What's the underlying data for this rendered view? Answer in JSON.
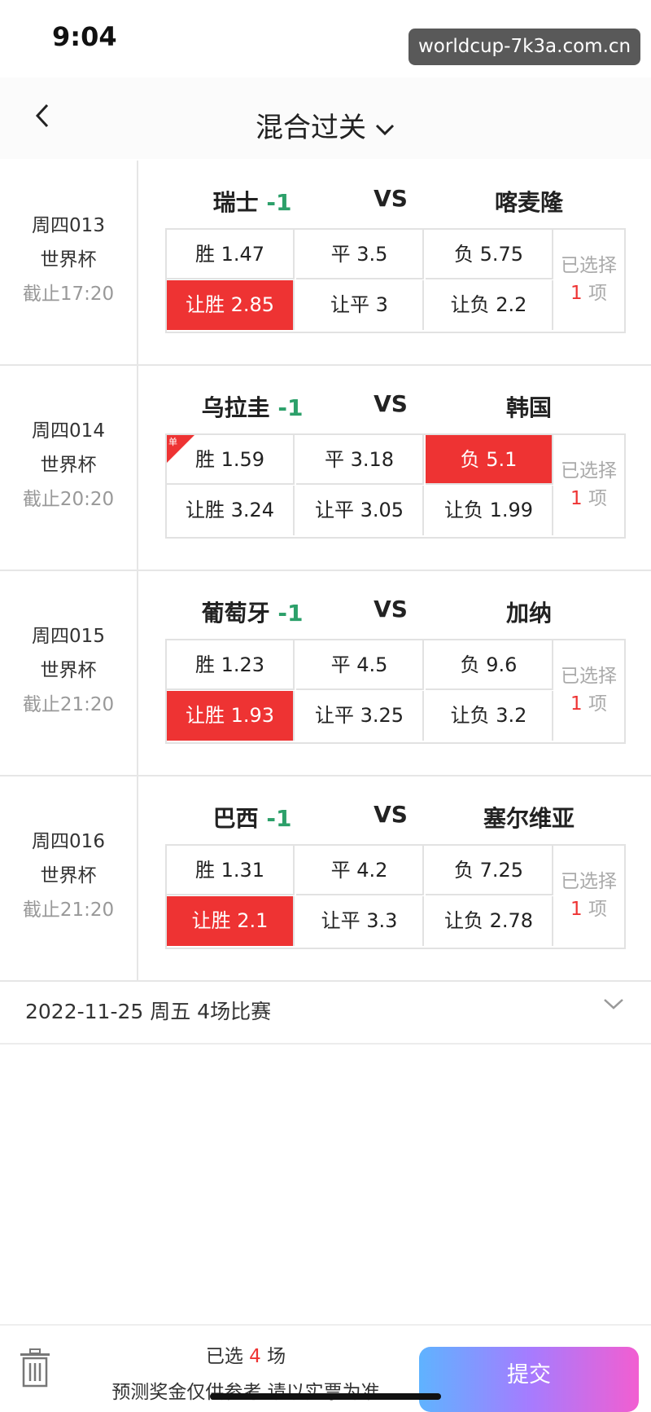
{
  "status": {
    "time": "9:04",
    "watermark": "worldcup-7k3a.com.cn"
  },
  "nav": {
    "title": "混合过关"
  },
  "matches": [
    {
      "code": "周四013",
      "league": "世界杯",
      "deadline": "截止17:20",
      "home": "瑞士",
      "handicap": "-1",
      "vs": "VS",
      "away": "喀麦隆",
      "odds": [
        "胜 1.47",
        "平 3.5",
        "负 5.75",
        "让胜 2.85",
        "让平 3",
        "让负 2.2"
      ],
      "selected": [
        3
      ],
      "single": false,
      "count_prefix": "已选择",
      "count": "1",
      "count_suffix": "项"
    },
    {
      "code": "周四014",
      "league": "世界杯",
      "deadline": "截止20:20",
      "home": "乌拉圭",
      "handicap": "-1",
      "vs": "VS",
      "away": "韩国",
      "odds": [
        "胜 1.59",
        "平 3.18",
        "负 5.1",
        "让胜 3.24",
        "让平 3.05",
        "让负 1.99"
      ],
      "selected": [
        2
      ],
      "single": true,
      "single_label": "单",
      "count_prefix": "已选择",
      "count": "1",
      "count_suffix": "项"
    },
    {
      "code": "周四015",
      "league": "世界杯",
      "deadline": "截止21:20",
      "home": "葡萄牙",
      "handicap": "-1",
      "vs": "VS",
      "away": "加纳",
      "odds": [
        "胜 1.23",
        "平 4.5",
        "负 9.6",
        "让胜 1.93",
        "让平 3.25",
        "让负 3.2"
      ],
      "selected": [
        3
      ],
      "single": false,
      "count_prefix": "已选择",
      "count": "1",
      "count_suffix": "项"
    },
    {
      "code": "周四016",
      "league": "世界杯",
      "deadline": "截止21:20",
      "home": "巴西",
      "handicap": "-1",
      "vs": "VS",
      "away": "塞尔维亚",
      "odds": [
        "胜 1.31",
        "平 4.2",
        "负 7.25",
        "让胜 2.1",
        "让平 3.3",
        "让负 2.78"
      ],
      "selected": [
        3
      ],
      "single": false,
      "count_prefix": "已选择",
      "count": "1",
      "count_suffix": "项"
    }
  ],
  "date_section": {
    "label": "2022-11-25 周五 4场比赛"
  },
  "bottom": {
    "selected_prefix": "已选",
    "selected_count": "4",
    "selected_suffix": "场",
    "note": "预测奖金仅供参考 请以实票为准",
    "submit_label": "提交"
  },
  "colors": {
    "selected": "#ee3333",
    "handicap": "#2ca06a"
  }
}
